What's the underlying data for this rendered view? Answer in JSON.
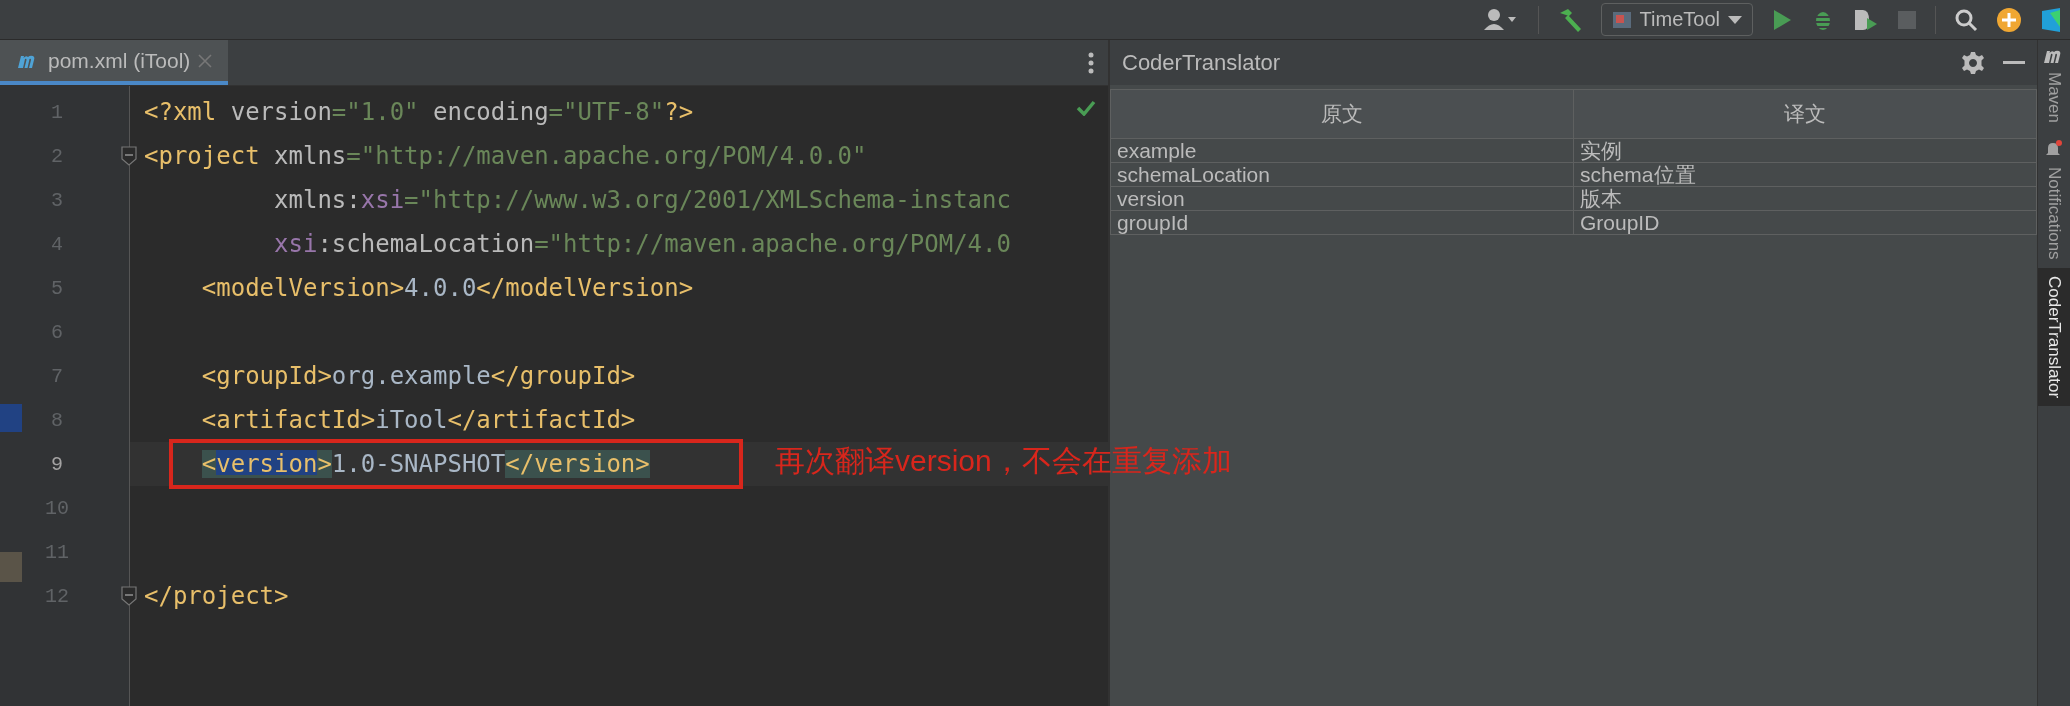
{
  "toolbar": {
    "run_config": "TimeTool"
  },
  "editor": {
    "tabs": [
      {
        "label": "pom.xml (iTool)",
        "selected": true
      }
    ],
    "lines": [
      {
        "number": "1",
        "kind": "top",
        "current": false,
        "fold": false,
        "segments": [
          {
            "kind": "tag",
            "t": "<?xml"
          },
          {
            "kind": "attr",
            "t": " version"
          },
          {
            "kind": "val",
            "t": "=\"1.0\""
          },
          {
            "kind": "attr",
            "t": " encoding"
          },
          {
            "kind": "val",
            "t": "=\"UTF-8\""
          },
          {
            "kind": "tag",
            "t": "?>"
          }
        ]
      },
      {
        "number": "2",
        "kind": "top",
        "current": false,
        "fold": true,
        "segments": [
          {
            "kind": "tag",
            "t": "<project"
          },
          {
            "kind": "attr",
            "t": " xmlns"
          },
          {
            "kind": "val",
            "t": "=\"http://maven.apache.org/POM/4.0.0\""
          }
        ]
      },
      {
        "number": "3",
        "kind": "continuation",
        "current": false,
        "fold": false,
        "segments": [
          {
            "kind": "attr",
            "t": "xmlns:"
          },
          {
            "kind": "ns",
            "t": "xsi"
          },
          {
            "kind": "val",
            "t": "=\"http://www.w3.org/2001/XMLSchema-instanc"
          }
        ]
      },
      {
        "number": "4",
        "kind": "continuation",
        "current": false,
        "fold": false,
        "segments": [
          {
            "kind": "ns",
            "t": "xsi"
          },
          {
            "kind": "attr",
            "t": ":schemaLocation"
          },
          {
            "kind": "val",
            "t": "=\"http://maven.apache.org/POM/4.0"
          }
        ]
      },
      {
        "number": "5",
        "kind": "nested",
        "current": false,
        "fold": false,
        "segments": [
          {
            "kind": "tag",
            "t": "<modelVersion>"
          },
          {
            "kind": "text",
            "t": "4.0.0"
          },
          {
            "kind": "tag",
            "t": "</modelVersion>"
          }
        ]
      },
      {
        "number": "6",
        "current": false,
        "fold": false
      },
      {
        "number": "7",
        "kind": "nested",
        "current": false,
        "fold": false,
        "segments": [
          {
            "kind": "tag",
            "t": "<groupId>"
          },
          {
            "kind": "text",
            "t": "org.example"
          },
          {
            "kind": "tag",
            "t": "</groupId>"
          }
        ]
      },
      {
        "number": "8",
        "kind": "nested",
        "current": false,
        "fold": false,
        "segments": [
          {
            "kind": "tag",
            "t": "<artifactId>"
          },
          {
            "kind": "text",
            "t": "iTool"
          },
          {
            "kind": "tag",
            "t": "</artifactId>"
          }
        ]
      },
      {
        "number": "9",
        "kind": "nested",
        "current": true,
        "fold": false,
        "segments": [
          {
            "kind": "tag",
            "t": "<",
            "paired": true,
            "selected": false
          },
          {
            "kind": "tag",
            "t": "version",
            "paired": true,
            "selected": true
          },
          {
            "kind": "tag",
            "t": ">",
            "paired": true,
            "selected": false
          },
          {
            "kind": "text",
            "t": "1.0-SNAPSHOT",
            "paired": false,
            "selected": false
          },
          {
            "kind": "tag",
            "t": "</version>",
            "paired": true,
            "selected": false
          }
        ]
      },
      {
        "number": "10",
        "current": false,
        "fold": false
      },
      {
        "number": "11",
        "current": false,
        "fold": false
      },
      {
        "number": "12",
        "kind": "top",
        "current": false,
        "fold": true,
        "segments": [
          {
            "kind": "tag",
            "t": "</project>"
          }
        ]
      }
    ]
  },
  "annotation": {
    "text": "再次翻译version，不会在重复添加"
  },
  "tool_window": {
    "title": "CoderTranslator",
    "table": {
      "columns": [
        "原文",
        "译文"
      ],
      "rows": [
        [
          "example",
          "实例"
        ],
        [
          "schemaLocation",
          "schema位置"
        ],
        [
          "version",
          "版本"
        ],
        [
          "groupId",
          "GroupID"
        ]
      ]
    }
  },
  "side_tabs": [
    {
      "label": "Maven",
      "kind": "maven",
      "selected": false
    },
    {
      "label": "Notifications",
      "kind": "notifications",
      "selected": false
    },
    {
      "label": "CoderTranslator",
      "kind": "plain",
      "selected": true
    }
  ]
}
